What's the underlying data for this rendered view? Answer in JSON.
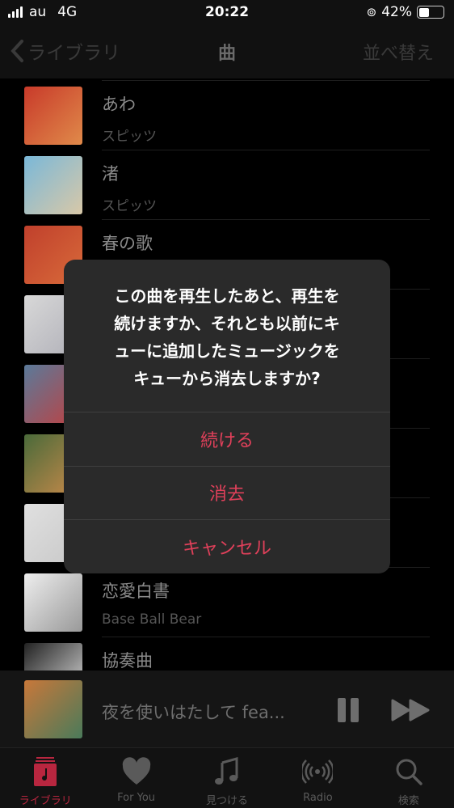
{
  "status_bar": {
    "carrier": "au",
    "network": "4G",
    "time": "20:22",
    "battery": "42%",
    "battery_level": 0.42
  },
  "nav": {
    "back_label": "ライブラリ",
    "title": "曲",
    "sort_label": "並べ替え"
  },
  "songs": [
    {
      "title": "",
      "artist": "",
      "art": [
        "#cfc8b8",
        "#a89880"
      ]
    },
    {
      "title": "あわ",
      "artist": "スピッツ",
      "art": [
        "#c83a2a",
        "#e08a4a"
      ]
    },
    {
      "title": "渚",
      "artist": "スピッツ",
      "art": [
        "#7ab8d8",
        "#d8c8a8"
      ]
    },
    {
      "title": "春の歌",
      "artist": "",
      "art": [
        "#c0402c",
        "#d86a3a"
      ]
    },
    {
      "title": "",
      "artist": "",
      "art": [
        "#d8d8d8",
        "#b0b0b8"
      ]
    },
    {
      "title": "",
      "artist": "",
      "art": [
        "#5a7a9a",
        "#c04040"
      ]
    },
    {
      "title": "",
      "artist": "",
      "art": [
        "#4a6a3a",
        "#c88a4a"
      ]
    },
    {
      "title": "",
      "artist": "",
      "art": [
        "#e0e0e0",
        "#c8c8c8"
      ]
    },
    {
      "title": "恋愛白書",
      "artist": "Base Ball Bear",
      "art": [
        "#eeeeee",
        "#999999"
      ]
    },
    {
      "title": "協奏曲",
      "artist": "",
      "art": [
        "#222222",
        "#dddddd"
      ]
    }
  ],
  "mini_player": {
    "title": "夜を使いはたして fea...",
    "art": [
      "#c8783a",
      "#4a7a5a"
    ]
  },
  "tabs": [
    {
      "label": "ライブラリ",
      "icon": "library-icon",
      "active": true
    },
    {
      "label": "For You",
      "icon": "heart-icon"
    },
    {
      "label": "見つける",
      "icon": "music-note-icon"
    },
    {
      "label": "Radio",
      "icon": "radio-icon"
    },
    {
      "label": "検索",
      "icon": "search-icon"
    }
  ],
  "dialog": {
    "message_lines": [
      "この曲を再生したあと、再生を",
      "続けますか、それとも以前にキ",
      "ューに追加したミュージックを",
      "キューから消去しますか?"
    ],
    "buttons": [
      "続ける",
      "消去",
      "キャンセル"
    ],
    "accent": "#e0405a"
  }
}
